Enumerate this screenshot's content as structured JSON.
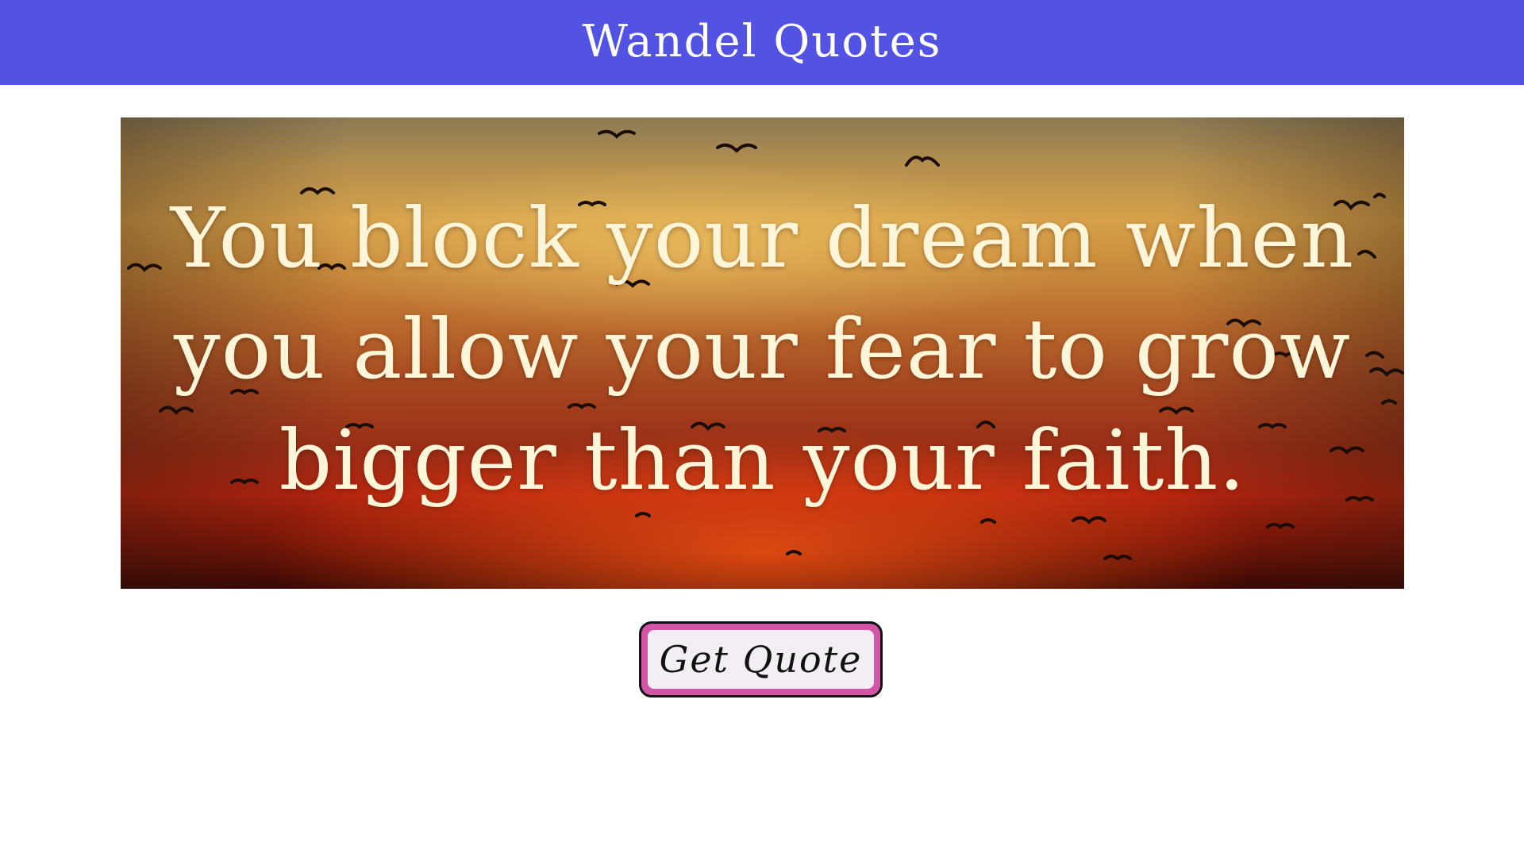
{
  "header": {
    "title": "Wandel Quotes",
    "background": "#5253e3"
  },
  "quote": {
    "text": "You block your dream when you allow your fear to grow bigger than your faith.",
    "background_image": "sunset-sky-with-birds"
  },
  "button": {
    "label": "Get Quote",
    "border_color": "#d255a7"
  }
}
